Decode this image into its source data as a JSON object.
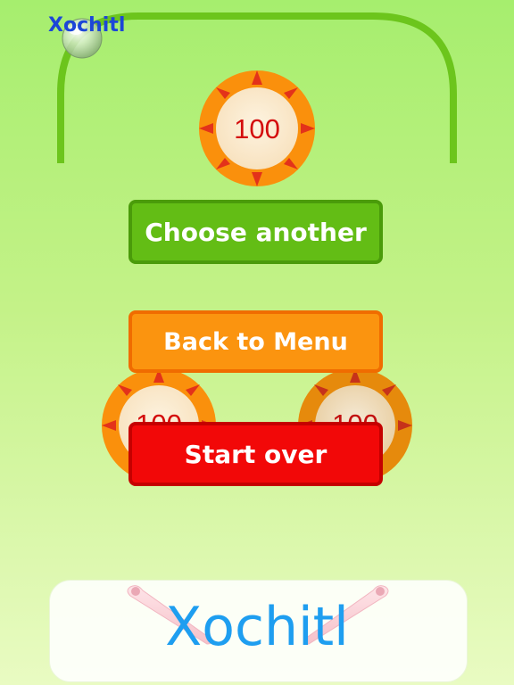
{
  "player": {
    "name": "Xochitl"
  },
  "bumper_value": "100",
  "buttons": {
    "choose_another": "Choose another",
    "back_to_menu": "Back to Menu",
    "start_over": "Start over"
  },
  "banner": {
    "name": "Xochitl"
  },
  "colors": {
    "rail": "#6cc51c",
    "choose_button": "#63bd15",
    "menu_button": "#fb940f",
    "start_button": "#f20808",
    "bumper_ring": "#fa900c",
    "bumper_text": "#d40d0d",
    "banner_text": "#1e9ef0"
  },
  "icons": [
    "pinball-ball-icon",
    "flipper-icon"
  ]
}
